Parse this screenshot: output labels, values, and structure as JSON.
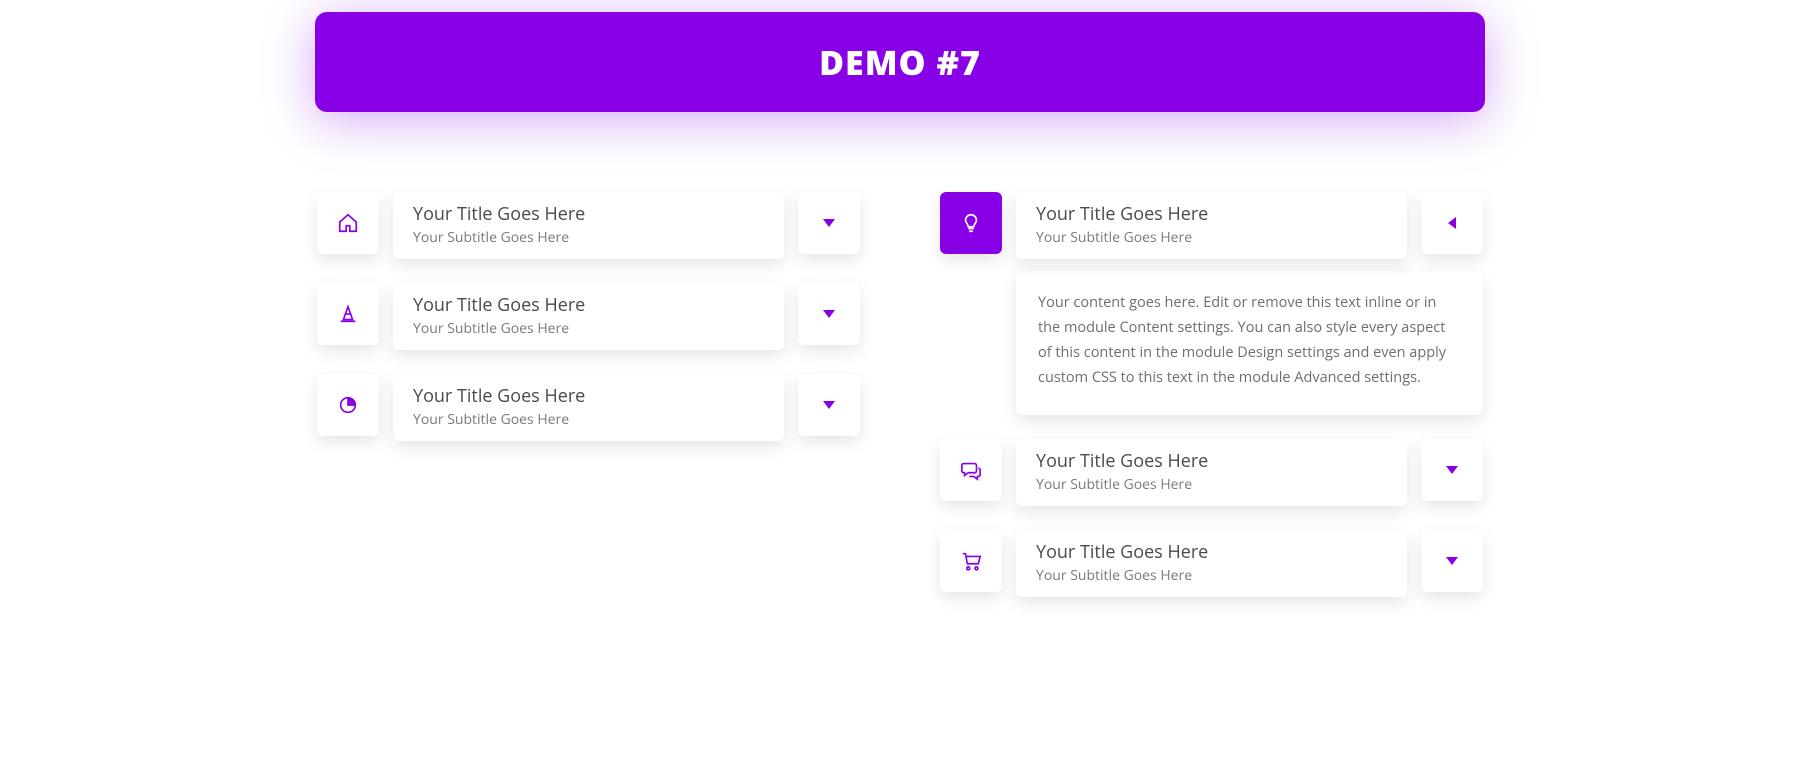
{
  "banner": {
    "title": "DEMO #7"
  },
  "left": {
    "items": [
      {
        "icon": "home-icon",
        "title": "Your Title Goes Here",
        "subtitle": "Your Subtitle Goes Here",
        "open": false
      },
      {
        "icon": "cone-icon",
        "title": "Your Title Goes Here",
        "subtitle": "Your Subtitle Goes Here",
        "open": false
      },
      {
        "icon": "pie-icon",
        "title": "Your Title Goes Here",
        "subtitle": "Your Subtitle Goes Here",
        "open": false
      }
    ]
  },
  "right": {
    "items": [
      {
        "icon": "bulb-icon",
        "title": "Your Title Goes Here",
        "subtitle": "Your Subtitle Goes Here",
        "open": true,
        "content": "Your content goes here. Edit or remove this text inline or in the module Content settings. You can also style every aspect of this content in the module Design settings and even apply custom CSS to this text in the module Advanced settings."
      },
      {
        "icon": "chat-icon",
        "title": "Your Title Goes Here",
        "subtitle": "Your Subtitle Goes Here",
        "open": false
      },
      {
        "icon": "cart-icon",
        "title": "Your Title Goes Here",
        "subtitle": "Your Subtitle Goes Here",
        "open": false
      }
    ]
  },
  "colors": {
    "accent": "#8700e6"
  }
}
